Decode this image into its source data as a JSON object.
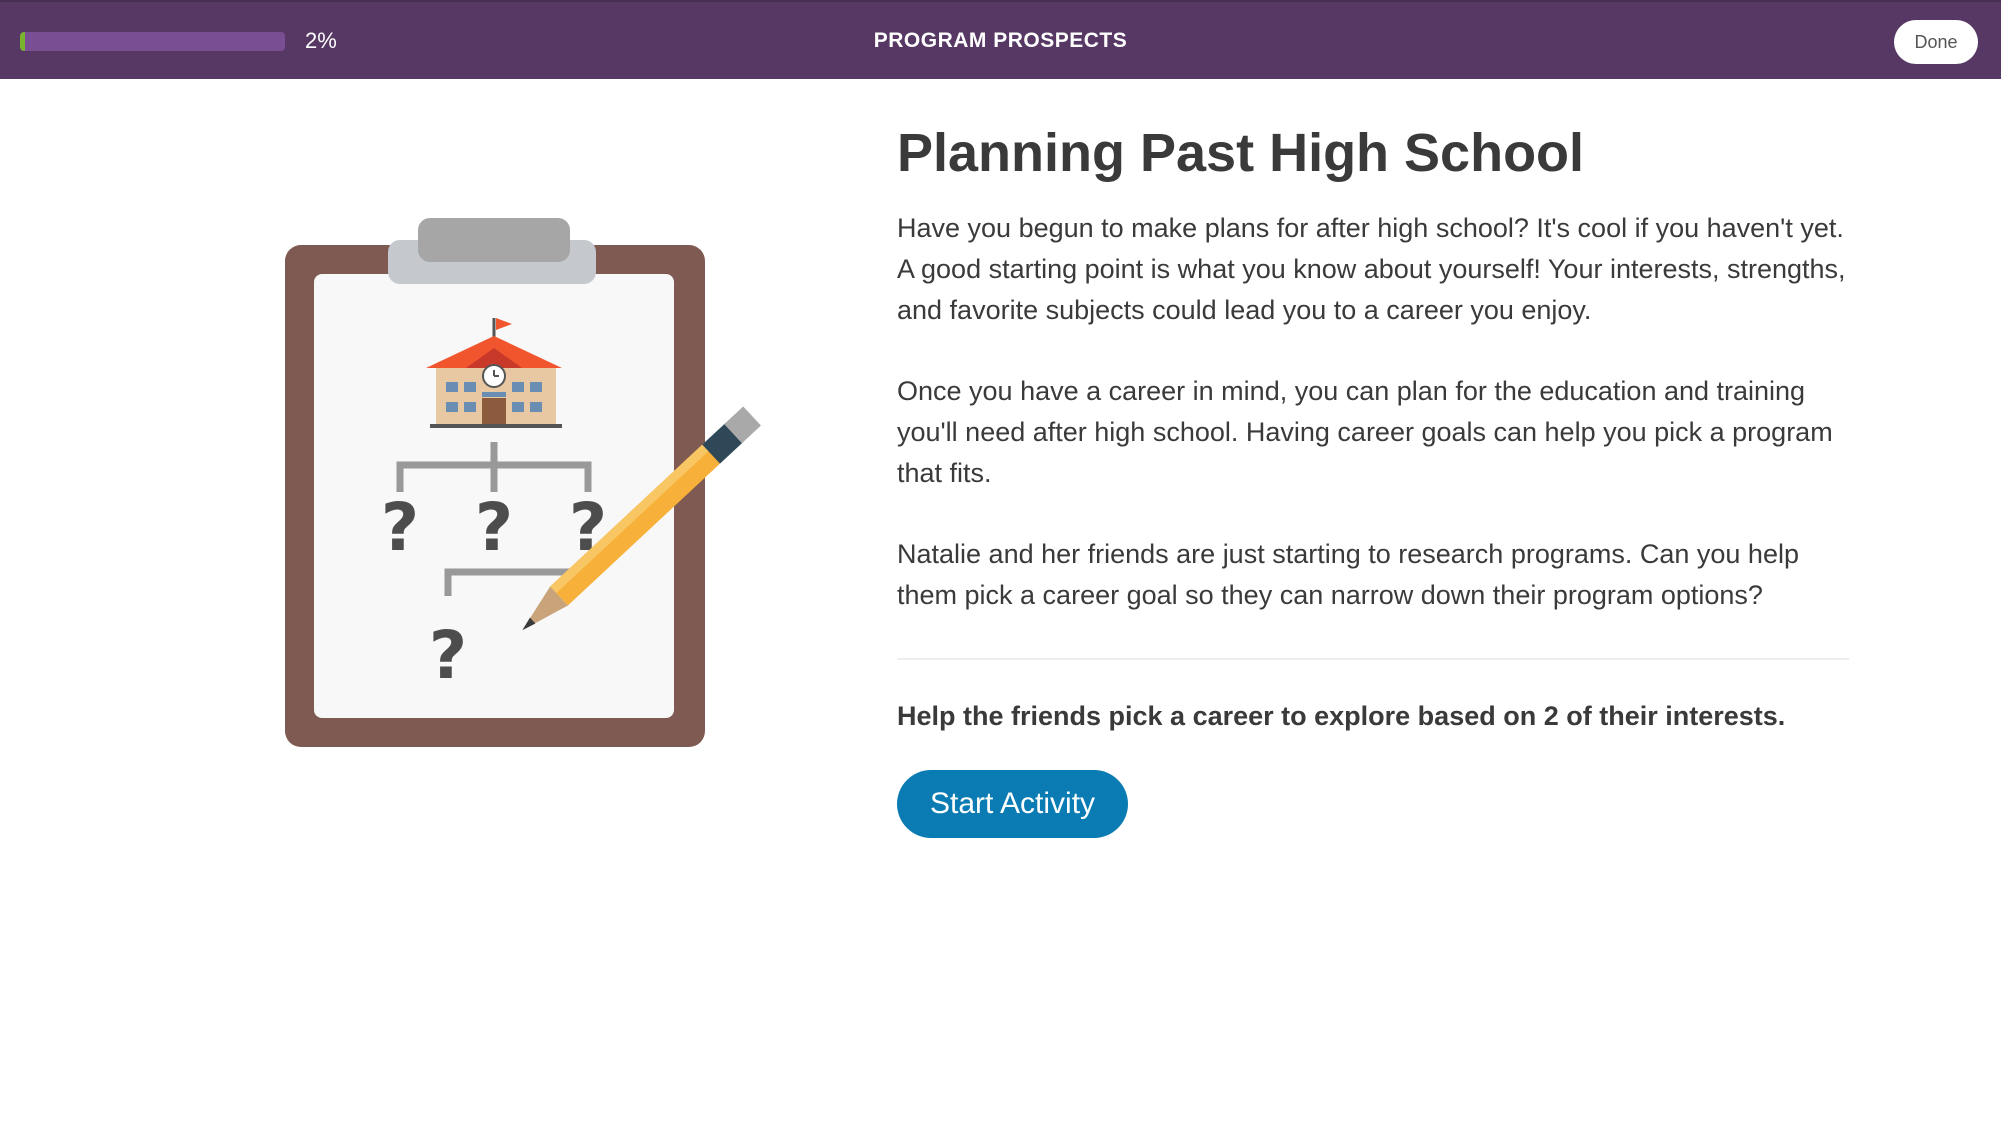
{
  "header": {
    "progress_percent": 2,
    "progress_label": "2%",
    "title": "PROGRAM PROSPECTS",
    "done_label": "Done"
  },
  "illustration": {
    "question_mark": "?"
  },
  "main": {
    "title": "Planning Past High School",
    "paragraphs": [
      "Have you begun to make plans for after high school? It's cool if you haven't yet. A good starting point is what you know about yourself! Your interests, strengths, and favorite subjects could lead you to a career you enjoy.",
      "Once you have a career in mind, you can plan for the education and training you'll need after high school. Having career goals can help you pick a program that fits.",
      "Natalie and her friends are just starting to research programs. Can you help them pick a career goal so they can narrow down their program options?"
    ],
    "prompt": "Help the friends pick a career to explore based on 2 of their interests.",
    "start_label": "Start Activity"
  },
  "colors": {
    "header_bg": "#573865",
    "progress_track": "#7a4e93",
    "progress_fill": "#7ab32e",
    "button_blue": "#0a7cb3",
    "clipboard_brown": "#7f5a52"
  }
}
